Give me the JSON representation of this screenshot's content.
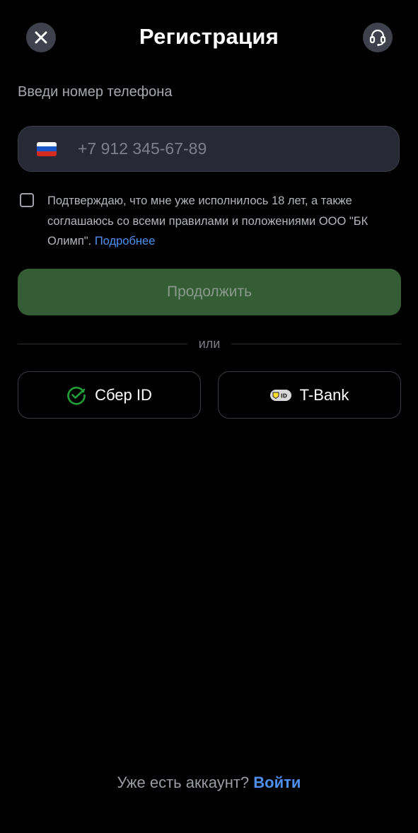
{
  "header": {
    "title": "Регистрация",
    "close_icon": "close-icon",
    "support_icon": "headset-icon"
  },
  "phone": {
    "prompt": "Введи номер телефона",
    "flag_icon": "russia-flag-icon",
    "placeholder": "+7 912 345-67-89",
    "value": ""
  },
  "consent": {
    "checked": false,
    "text": "Подтверждаю, что мне уже исполнилось 18 лет, а также соглашаюсь со всеми правилами и положениями ООО \"БК Олимп\".",
    "link_label": "Подробнее"
  },
  "continue_button": {
    "label": "Продолжить",
    "enabled": false
  },
  "divider": {
    "label": "или"
  },
  "alt_login": {
    "sber_label": "Сбер ID",
    "sber_icon": "sber-check-icon",
    "tbank_label": "T-Bank",
    "tbank_icon": "tbank-id-icon"
  },
  "footer": {
    "text": "Уже есть аккаунт?",
    "link_label": "Войти"
  },
  "colors": {
    "background": "#000000",
    "accent_link": "#4f8ff0",
    "continue_bg": "#355d35",
    "field_bg": "#272a35",
    "sber_green": "#21a038"
  }
}
